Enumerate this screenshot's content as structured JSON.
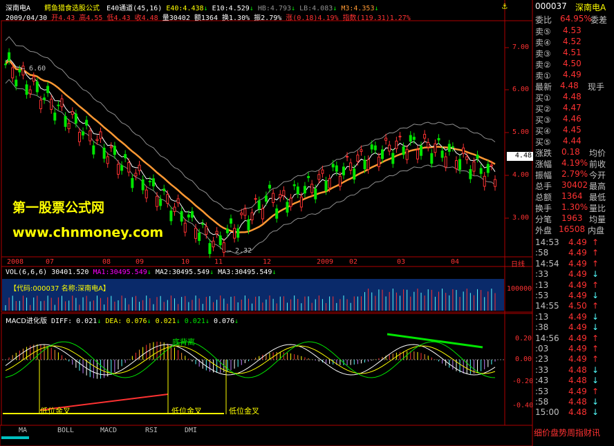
{
  "header": {
    "stock_name": "深南电A",
    "formula_title": "鳄鱼猎食选股公式",
    "channel": "E40通道(45,16)",
    "e40": "E40:4.438",
    "e10": "E10:4.529",
    "hb": "HB:4.793",
    "lb": "LB:4.083",
    "m3": "M3:4.353",
    "date": "2009/04/30",
    "open": "开4.43",
    "high": "高4.55",
    "low": "低4.43",
    "close": "收4.48",
    "volume": "量30402",
    "amount": "额1364",
    "turnover": "换1.30%",
    "amplitude": "振2.79%",
    "change": "涨(0.18)4.19%",
    "index": "指数(119.31)1.27%"
  },
  "price_axis": [
    "7.00",
    "6.00",
    "5.00",
    "4.00",
    "3.00"
  ],
  "price_markers": {
    "high_label": "6.60",
    "low_label": "2.32",
    "current": "4.48"
  },
  "watermark": {
    "line1": "第一股票公式网",
    "line2": "www.chnmoney.com"
  },
  "date_axis": [
    "2008",
    "07",
    "08",
    "09",
    "10",
    "11",
    "12",
    "2009",
    "02",
    "03",
    "04"
  ],
  "date_axis_right": "日线",
  "volume_header": {
    "vol": "VOL(6,6,6)",
    "vol_val": "30401.520",
    "ma1": "MA1:30495.549",
    "ma2": "MA2:30495.549",
    "ma3": "MA3:30495.549"
  },
  "volume_info": "【代码:000037 名称:深南电A】",
  "volume_axis": "100000",
  "macd_header": {
    "title": "MACD进化版",
    "diff": "DIFF: 0.021",
    "dea": "DEA: 0.076",
    "v1": "0.021",
    "v2": "0.021",
    "v3": "0.076"
  },
  "macd_axis": [
    "0.20",
    "0.00",
    "-0.20",
    "-0.40"
  ],
  "macd_annotations": {
    "divergence": "底背离",
    "golden1": "低位金叉",
    "golden2": "低位金叉",
    "golden3": "低位金叉"
  },
  "bottom_tabs": [
    "MA",
    "BOLL",
    "MACD",
    "RSI",
    "DMI"
  ],
  "side_panel": {
    "code": "000037",
    "name": "深南电A",
    "weibi_label": "委比",
    "weibi": "64.95%",
    "weicha": "委差",
    "sell": [
      {
        "label": "卖⑤",
        "price": "4.53"
      },
      {
        "label": "卖④",
        "price": "4.52"
      },
      {
        "label": "卖③",
        "price": "4.51"
      },
      {
        "label": "卖②",
        "price": "4.50"
      },
      {
        "label": "卖①",
        "price": "4.49"
      }
    ],
    "latest_label": "最新",
    "latest": "4.48",
    "xianshou": "现手",
    "buy": [
      {
        "label": "买①",
        "price": "4.48"
      },
      {
        "label": "买②",
        "price": "4.47"
      },
      {
        "label": "买③",
        "price": "4.46"
      },
      {
        "label": "买④",
        "price": "4.45"
      },
      {
        "label": "买⑤",
        "price": "4.44"
      }
    ],
    "stats": [
      {
        "label": "涨跌",
        "value": "0.18",
        "label2": "均价"
      },
      {
        "label": "涨幅",
        "value": "4.19%",
        "label2": "前收"
      },
      {
        "label": "振幅",
        "value": "2.79%",
        "label2": "今开"
      },
      {
        "label": "总手",
        "value": "30402",
        "label2": "最高"
      },
      {
        "label": "总额",
        "value": "1364",
        "label2": "最低"
      },
      {
        "label": "换手",
        "value": "1.30%",
        "label2": "量比"
      },
      {
        "label": "分笔",
        "value": "1963",
        "label2": "均量"
      }
    ],
    "waipan_label": "外盘",
    "waipan": "16508",
    "neipan": "内盘",
    "ticks": [
      {
        "time": "14:53",
        "price": "4.49",
        "dir": "↑"
      },
      {
        "time": ":58",
        "price": "4.49",
        "dir": "↑"
      },
      {
        "time": "14:54",
        "price": "4.49",
        "dir": "↑"
      },
      {
        "time": ":33",
        "price": "4.49",
        "dir": "↓"
      },
      {
        "time": ":13",
        "price": "4.49",
        "dir": "↑"
      },
      {
        "time": ":53",
        "price": "4.49",
        "dir": "↓"
      },
      {
        "time": "14:55",
        "price": "4.50",
        "dir": "↑"
      },
      {
        "time": ":13",
        "price": "4.49",
        "dir": "↓"
      },
      {
        "time": ":38",
        "price": "4.49",
        "dir": "↓"
      },
      {
        "time": "14:56",
        "price": "4.49",
        "dir": "↑"
      },
      {
        "time": ":03",
        "price": "4.49",
        "dir": "↑"
      },
      {
        "time": ":23",
        "price": "4.49",
        "dir": "↑"
      },
      {
        "time": ":33",
        "price": "4.48",
        "dir": "↓"
      },
      {
        "time": ":43",
        "price": "4.48",
        "dir": "↓"
      },
      {
        "time": ":53",
        "price": "4.49",
        "dir": "↑"
      },
      {
        "time": ":58",
        "price": "4.48",
        "dir": "↓"
      },
      {
        "time": "15:00",
        "price": "4.48",
        "dir": "↓"
      }
    ],
    "bottom_tabs": "细价盘势周指财讯"
  },
  "colors": {
    "up": "#ff3232",
    "down": "#54ffff",
    "yellow": "#ffff00",
    "green": "#00e600",
    "orange": "#ff9933",
    "white": "#ffffff",
    "grid": "#b00000"
  }
}
